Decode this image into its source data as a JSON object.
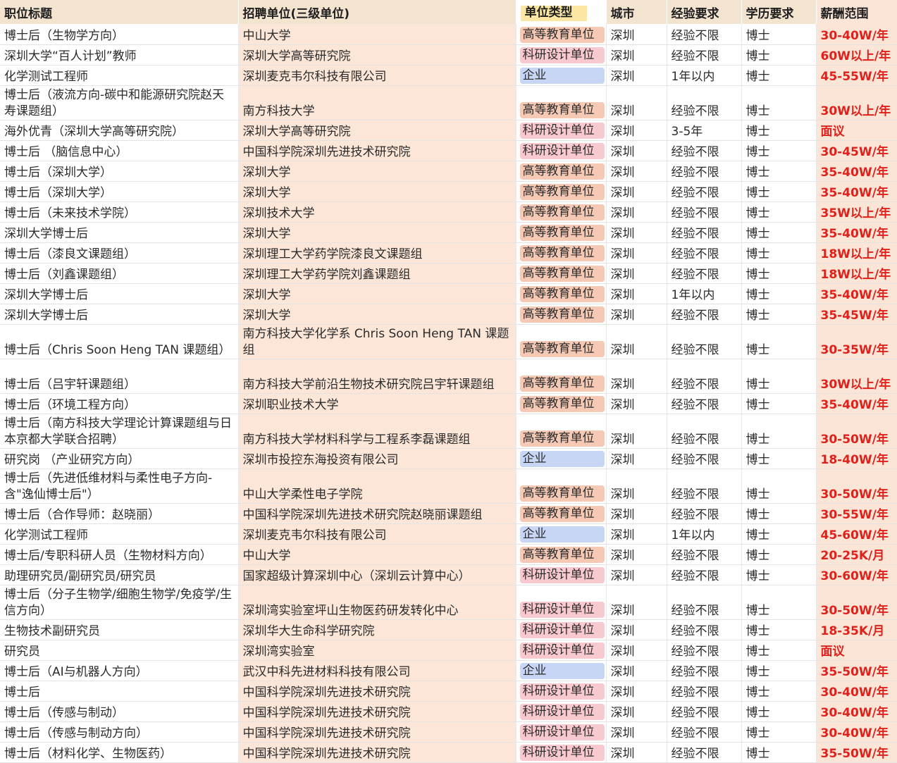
{
  "headers": [
    "职位标题",
    "招聘单位(三级单位)",
    "单位类型",
    "城市",
    "经验要求",
    "学历要求",
    "薪酬范围"
  ],
  "colors": {
    "edu": "#f6c9b5",
    "res": "#f8c9cf",
    "ent": "#c7d6f5",
    "salary": "#e0201b"
  },
  "rows": [
    {
      "title": "博士后（生物学方向）",
      "unit": "中山大学",
      "type": "高等教育单位",
      "city": "深圳",
      "exp": "经验不限",
      "edu": "博士",
      "salary": "30-40W/年"
    },
    {
      "title": "深圳大学“百人计划”教师",
      "unit": "深圳大学高等研究院",
      "type": "科研设计单位",
      "city": "深圳",
      "exp": "经验不限",
      "edu": "博士",
      "salary": "60W以上/年"
    },
    {
      "title": "化学测试工程师",
      "unit": "深圳麦克韦尔科技有限公司",
      "type": "企业",
      "city": "深圳",
      "exp": "1年以内",
      "edu": "博士",
      "salary": "45-55W/年"
    },
    {
      "title": "博士后（液流方向-碳中和能源研究院赵天寿课题组）",
      "unit": "南方科技大学",
      "type": "高等教育单位",
      "city": "深圳",
      "exp": "经验不限",
      "edu": "博士",
      "salary": "30W以上/年"
    },
    {
      "title": "海外优青（深圳大学高等研究院）",
      "unit": "深圳大学高等研究院",
      "type": "科研设计单位",
      "city": "深圳",
      "exp": "3-5年",
      "edu": "博士",
      "salary": "面议"
    },
    {
      "title": "博士后 （脑信息中心）",
      "unit": "中国科学院深圳先进技术研究院",
      "type": "科研设计单位",
      "city": "深圳",
      "exp": "经验不限",
      "edu": "博士",
      "salary": "30-45W/年"
    },
    {
      "title": "博士后（深圳大学）",
      "unit": "深圳大学",
      "type": "高等教育单位",
      "city": "深圳",
      "exp": "经验不限",
      "edu": "博士",
      "salary": "35-40W/年"
    },
    {
      "title": "博士后（深圳大学）",
      "unit": "深圳大学",
      "type": "高等教育单位",
      "city": "深圳",
      "exp": "经验不限",
      "edu": "博士",
      "salary": "35-40W/年"
    },
    {
      "title": "博士后（未来技术学院）",
      "unit": "深圳技术大学",
      "type": "高等教育单位",
      "city": "深圳",
      "exp": "经验不限",
      "edu": "博士",
      "salary": "35W以上/年"
    },
    {
      "title": "深圳大学博士后",
      "unit": "深圳大学",
      "type": "高等教育单位",
      "city": "深圳",
      "exp": "经验不限",
      "edu": "博士",
      "salary": "35-40W/年"
    },
    {
      "title": "博士后（漆良文课题组）",
      "unit": "深圳理工大学药学院漆良文课题组",
      "type": "高等教育单位",
      "city": "深圳",
      "exp": "经验不限",
      "edu": "博士",
      "salary": "18W以上/年"
    },
    {
      "title": "博士后（刘鑫课题组）",
      "unit": "深圳理工大学药学院刘鑫课题组",
      "type": "高等教育单位",
      "city": "深圳",
      "exp": "经验不限",
      "edu": "博士",
      "salary": "18W以上/年"
    },
    {
      "title": "深圳大学博士后",
      "unit": "深圳大学",
      "type": "高等教育单位",
      "city": "深圳",
      "exp": "1年以内",
      "edu": "博士",
      "salary": "35-40W/年"
    },
    {
      "title": "深圳大学博士后",
      "unit": "深圳大学",
      "type": "高等教育单位",
      "city": "深圳",
      "exp": "经验不限",
      "edu": "博士",
      "salary": "35-45W/年"
    },
    {
      "title": "博士后（Chris Soon Heng TAN 课题组）",
      "unit": "南方科技大学化学系 Chris Soon Heng TAN 课题组",
      "type": "高等教育单位",
      "city": "深圳",
      "exp": "经验不限",
      "edu": "博士",
      "salary": "30-35W/年"
    },
    {
      "title": "博士后（吕宇轩课题组）",
      "unit": "南方科技大学前沿生物技术研究院吕宇轩课题组",
      "type": "高等教育单位",
      "city": "深圳",
      "exp": "经验不限",
      "edu": "博士",
      "salary": "30W以上/年"
    },
    {
      "title": "博士后（环境工程方向）",
      "unit": "深圳职业技术大学",
      "type": "高等教育单位",
      "city": "深圳",
      "exp": "经验不限",
      "edu": "博士",
      "salary": "35-40W/年"
    },
    {
      "title": "博士后（南方科技大学理论计算课题组与日本京都大学联合招聘）",
      "unit": "南方科技大学材料科学与工程系李磊课题组",
      "type": "高等教育单位",
      "city": "深圳",
      "exp": "经验不限",
      "edu": "博士",
      "salary": "30-50W/年"
    },
    {
      "title": "研究岗 （产业研究方向）",
      "unit": "深圳市投控东海投资有限公司",
      "type": "企业",
      "city": "深圳",
      "exp": "经验不限",
      "edu": "博士",
      "salary": "18-40W/年"
    },
    {
      "title": "博士后（先进低维材料与柔性电子方向-含\"逸仙博士后\"）",
      "unit": "中山大学柔性电子学院",
      "type": "高等教育单位",
      "city": "深圳",
      "exp": "经验不限",
      "edu": "博士",
      "salary": "30-50W/年"
    },
    {
      "title": "博士后（合作导师：赵晓丽）",
      "unit": "中国科学院深圳先进技术研究院赵晓丽课题组",
      "type": "高等教育单位",
      "city": "深圳",
      "exp": "经验不限",
      "edu": "博士",
      "salary": "30-55W/年"
    },
    {
      "title": "化学测试工程师",
      "unit": "深圳麦克韦尔科技有限公司",
      "type": "企业",
      "city": "深圳",
      "exp": "1年以内",
      "edu": "博士",
      "salary": "45-60W/年"
    },
    {
      "title": "博士后/专职科研人员（生物材料方向）",
      "unit": "中山大学",
      "type": "高等教育单位",
      "city": "深圳",
      "exp": "经验不限",
      "edu": "博士",
      "salary": "20-25K/月"
    },
    {
      "title": "助理研究员/副研究员/研究员",
      "unit": "国家超级计算深圳中心（深圳云计算中心）",
      "type": "科研设计单位",
      "city": "深圳",
      "exp": "经验不限",
      "edu": "博士",
      "salary": "30-60W/年"
    },
    {
      "title": "博士后（分子生物学/细胞生物学/免疫学/生信方向）",
      "unit": "深圳湾实验室坪山生物医药研发转化中心",
      "type": "科研设计单位",
      "city": "深圳",
      "exp": "经验不限",
      "edu": "博士",
      "salary": "30-50W/年"
    },
    {
      "title": "生物技术副研究员",
      "unit": "深圳华大生命科学研究院",
      "type": "科研设计单位",
      "city": "深圳",
      "exp": "经验不限",
      "edu": "博士",
      "salary": "18-35K/月"
    },
    {
      "title": "研究员",
      "unit": "深圳湾实验室",
      "type": "科研设计单位",
      "city": "深圳",
      "exp": "经验不限",
      "edu": "博士",
      "salary": "面议"
    },
    {
      "title": "博士后（AI与机器人方向）",
      "unit": "武汉中科先进材料科技有限公司",
      "type": "企业",
      "city": "深圳",
      "exp": "经验不限",
      "edu": "博士",
      "salary": "35-50W/年"
    },
    {
      "title": "博士后",
      "unit": "中国科学院深圳先进技术研究院",
      "type": "科研设计单位",
      "city": "深圳",
      "exp": "经验不限",
      "edu": "博士",
      "salary": "30-40W/年"
    },
    {
      "title": "博士后（传感与制动）",
      "unit": "中国科学院深圳先进技术研究院",
      "type": "科研设计单位",
      "city": "深圳",
      "exp": "经验不限",
      "edu": "博士",
      "salary": "30-40W/年"
    },
    {
      "title": "博士后（传感与制动方向）",
      "unit": "中国科学院深圳先进技术研究院",
      "type": "科研设计单位",
      "city": "深圳",
      "exp": "经验不限",
      "edu": "博士",
      "salary": "30-40W/年"
    },
    {
      "title": "博士后（材料化学、生物医药）",
      "unit": "中国科学院深圳先进技术研究院",
      "type": "科研设计单位",
      "city": "深圳",
      "exp": "经验不限",
      "edu": "博士",
      "salary": "35-50W/年"
    }
  ]
}
